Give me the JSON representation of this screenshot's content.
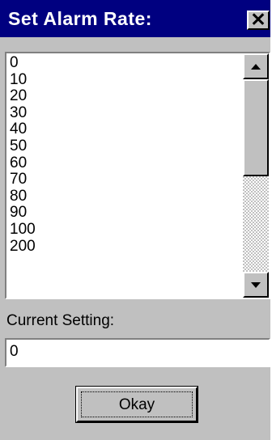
{
  "window": {
    "title": "Set Alarm Rate:",
    "close_glyph": "✕"
  },
  "list": {
    "items": [
      "0",
      "10",
      "20",
      "30",
      "40",
      "50",
      "60",
      "70",
      "80",
      "90",
      "100",
      "200"
    ],
    "scroll_position_fraction": 0.0
  },
  "current_setting": {
    "label": "Current Setting:",
    "value": "0"
  },
  "okay_button": {
    "label": "Okay"
  },
  "icons": {
    "close": "close-icon",
    "scroll_up": "arrow-up-icon",
    "scroll_down": "arrow-down-icon"
  },
  "colors": {
    "titlebar": "#000080",
    "face": "#c0c0c0",
    "field": "#ffffff"
  }
}
